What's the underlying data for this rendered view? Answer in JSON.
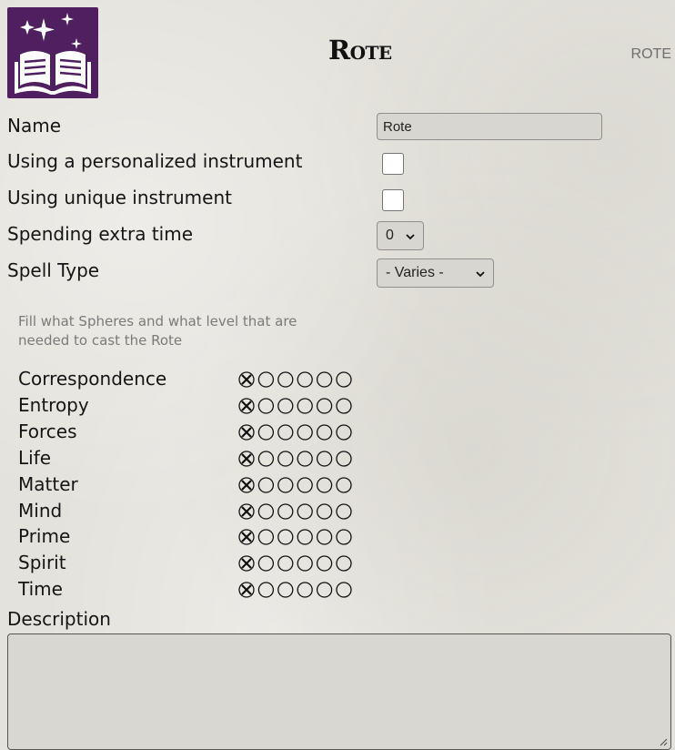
{
  "header": {
    "title": "Rote",
    "tag": "ROTE"
  },
  "form": {
    "name_label": "Name",
    "name_value": "Rote",
    "personalized_label": "Using a personalized instrument",
    "unique_label": "Using unique instrument",
    "extra_time_label": "Spending extra time",
    "extra_time_value": "0",
    "spell_type_label": "Spell Type",
    "spell_type_value": "- Varies -"
  },
  "spheres": {
    "hint": "Fill what Spheres and what level that are needed to cast the Rote",
    "items": [
      {
        "name": "Correspondence",
        "level": 0
      },
      {
        "name": "Entropy",
        "level": 0
      },
      {
        "name": "Forces",
        "level": 0
      },
      {
        "name": "Life",
        "level": 0
      },
      {
        "name": "Matter",
        "level": 0
      },
      {
        "name": "Mind",
        "level": 0
      },
      {
        "name": "Prime",
        "level": 0
      },
      {
        "name": "Spirit",
        "level": 0
      },
      {
        "name": "Time",
        "level": 0
      }
    ],
    "max_level": 5
  },
  "description": {
    "label": "Description",
    "value": ""
  },
  "colors": {
    "logo_bg": "#4f1f60",
    "tag": "#6e6e6e",
    "hint": "#7a7a7a"
  },
  "icons": {
    "logo": "open-book-sparkles-icon",
    "reset": "circled-x-icon",
    "dot": "empty-circle-icon"
  }
}
